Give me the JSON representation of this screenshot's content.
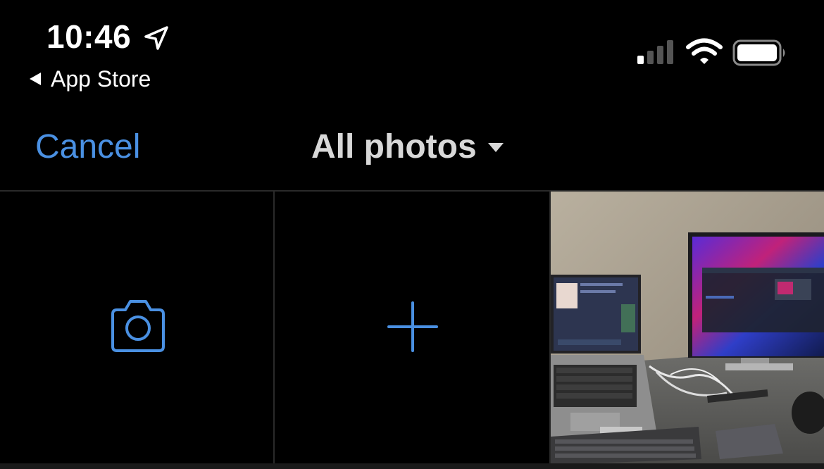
{
  "status_bar": {
    "time": "10:46",
    "back_label": "App Store",
    "icons": [
      "location-arrow-icon",
      "back-triangle-icon",
      "cellular-signal-icon",
      "wifi-icon",
      "battery-icon"
    ]
  },
  "nav": {
    "cancel_label": "Cancel",
    "album_title": "All photos",
    "album_chevron": "chevron-down-icon"
  },
  "grid": {
    "tiles": [
      {
        "kind": "camera",
        "icon": "camera-icon"
      },
      {
        "kind": "add",
        "icon": "plus-icon"
      },
      {
        "kind": "photo",
        "icon": "photo-thumbnail"
      }
    ]
  },
  "colors": {
    "accent": "#4a90e2",
    "background": "#000000",
    "title": "#d8d8d8",
    "divider": "#2a2a2a"
  }
}
